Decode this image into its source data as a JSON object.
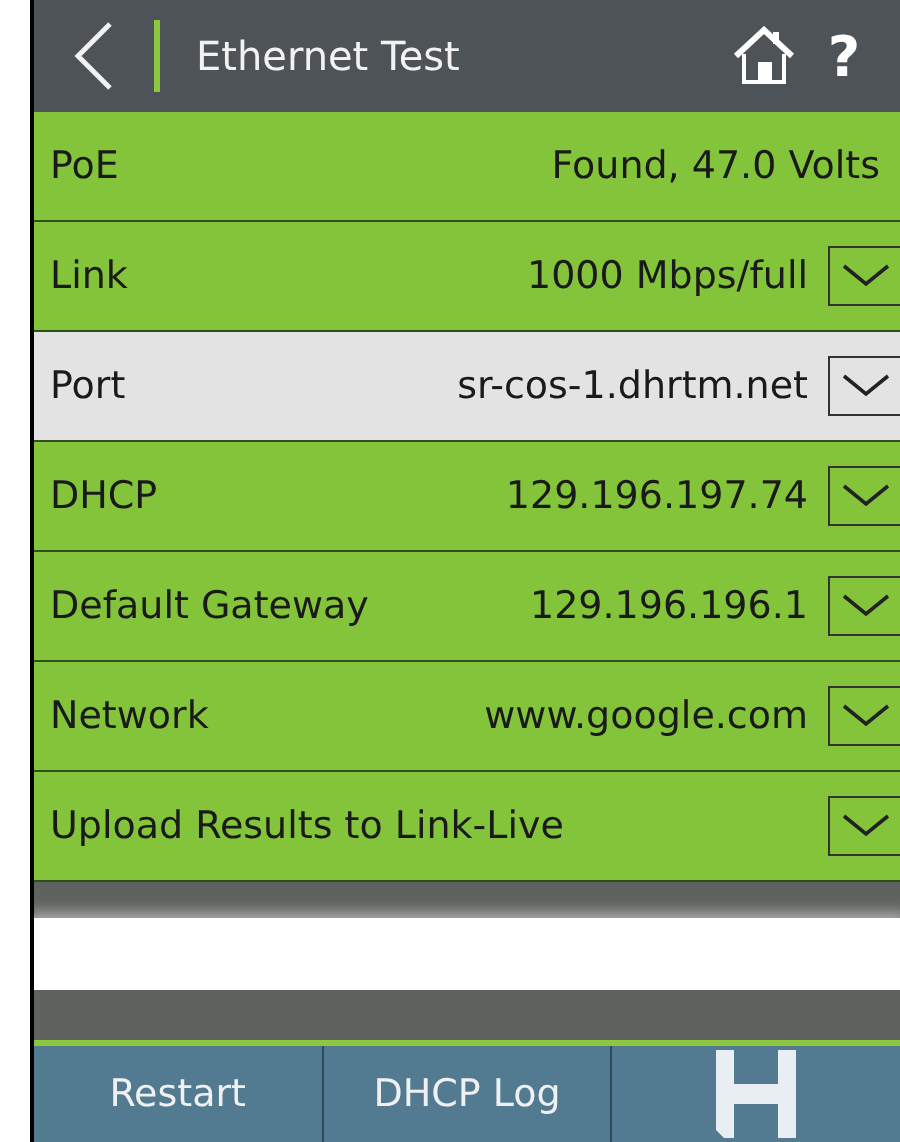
{
  "header": {
    "title": "Ethernet Test",
    "help": "?"
  },
  "rows": [
    {
      "kind": "plain",
      "label": "PoE",
      "value": "Found,  47.0 Volts",
      "selected": false
    },
    {
      "kind": "dropdown",
      "label": "Link",
      "value": "1000 Mbps/full",
      "selected": false
    },
    {
      "kind": "dropdown",
      "label": "Port",
      "value": "sr-cos-1.dhrtm.net",
      "selected": true
    },
    {
      "kind": "dropdown",
      "label": "DHCP",
      "value": "129.196.197.74",
      "selected": false
    },
    {
      "kind": "dropdown",
      "label": "Default Gateway",
      "value": "129.196.196.1",
      "selected": false
    },
    {
      "kind": "dropdown",
      "label": "Network",
      "value": "www.google.com",
      "selected": false
    },
    {
      "kind": "dropdown",
      "label": "Upload Results to Link-Live",
      "selected": false
    }
  ],
  "toolbar": [
    {
      "kind": "text",
      "label": "Restart"
    },
    {
      "kind": "text",
      "label": "DHCP Log"
    },
    {
      "kind": "save"
    }
  ]
}
